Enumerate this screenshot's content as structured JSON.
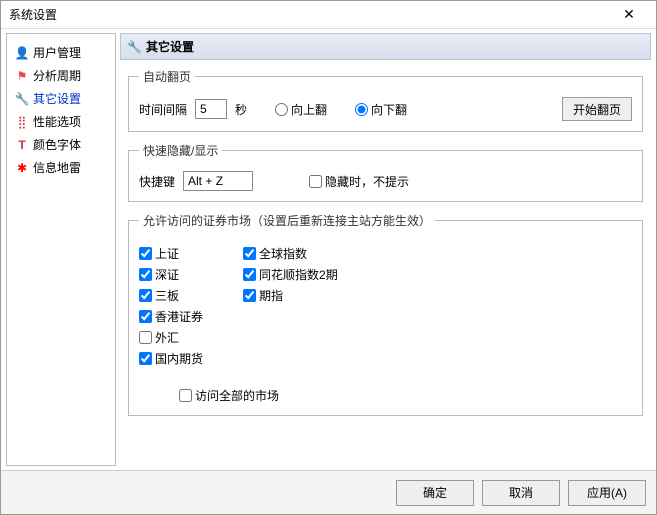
{
  "window": {
    "title": "系统设置"
  },
  "sidebar": {
    "items": [
      {
        "label": "用户管理"
      },
      {
        "label": "分析周期"
      },
      {
        "label": "其它设置"
      },
      {
        "label": "性能选项"
      },
      {
        "label": "颜色字体"
      },
      {
        "label": "信息地雷"
      }
    ]
  },
  "header": {
    "title": "其它设置"
  },
  "autopage": {
    "legend": "自动翻页",
    "interval_label": "时间间隔",
    "interval_value": "5",
    "seconds": "秒",
    "up_label": "向上翻",
    "down_label": "向下翻",
    "start_button": "开始翻页"
  },
  "quickhide": {
    "legend": "快速隐藏/显示",
    "hotkey_label": "快捷键",
    "hotkey_value": "Alt + Z",
    "noprompt_label": "隐藏时，不提示"
  },
  "markets": {
    "legend": "允许访问的证券市场（设置后重新连接主站方能生效）",
    "col1": [
      {
        "label": "上证",
        "checked": true
      },
      {
        "label": "深证",
        "checked": true
      },
      {
        "label": "三板",
        "checked": true
      },
      {
        "label": "香港证券",
        "checked": true
      },
      {
        "label": "外汇",
        "checked": false
      },
      {
        "label": "国内期货",
        "checked": true
      }
    ],
    "col2": [
      {
        "label": "全球指数",
        "checked": true
      },
      {
        "label": "同花顺指数2期",
        "checked": true
      },
      {
        "label": "期指",
        "checked": true
      }
    ],
    "access_all_label": "访问全部的市场"
  },
  "footer": {
    "ok": "确定",
    "cancel": "取消",
    "apply": "应用(A)"
  }
}
